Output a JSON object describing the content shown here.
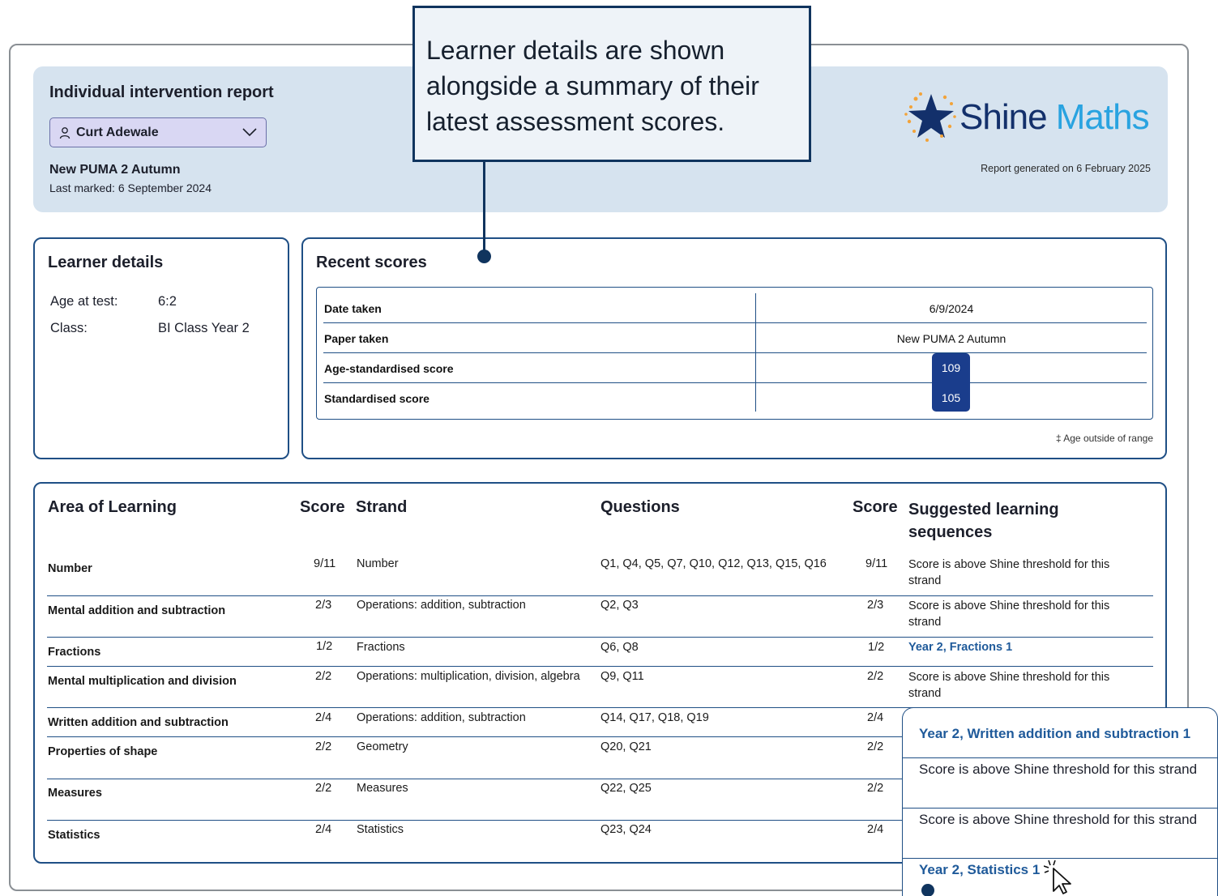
{
  "header": {
    "title": "Individual intervention report",
    "learner": "Curt Adewale",
    "paper": "New PUMA 2 Autumn",
    "last_marked": "Last marked: 6 September 2024",
    "logo_part1": "Shine",
    "logo_part2": " Maths",
    "generated": "Report generated on 6 February 2025"
  },
  "callout": {
    "text": "Learner details are shown alongside a summary of their latest assessment scores."
  },
  "learner_details": {
    "title": "Learner details",
    "age_label": "Age at test:",
    "age_value": "6:2",
    "class_label": "Class:",
    "class_value": "BI Class Year 2"
  },
  "recent_scores": {
    "title": "Recent scores",
    "rows": [
      {
        "label": "Date taken",
        "value": "6/9/2024"
      },
      {
        "label": "Paper taken",
        "value": "New PUMA 2 Autumn"
      },
      {
        "label": "Age-standardised score",
        "value": "109"
      },
      {
        "label": "Standardised score",
        "value": "105"
      }
    ],
    "note": "‡ Age outside of range"
  },
  "areas": {
    "headers": {
      "area": "Area of Learning",
      "score": "Score",
      "strand": "Strand",
      "questions": "Questions",
      "score2": "Score",
      "suggested": "Suggested learning sequences"
    },
    "rows": [
      {
        "area": "Number",
        "score": "9/11",
        "strand": "Number",
        "questions": "Q1, Q4, Q5, Q7, Q10, Q12, Q13, Q15, Q16",
        "score2": "9/11",
        "suggested": "Score is above Shine threshold for this strand"
      },
      {
        "area": "Mental addition and subtraction",
        "score": "2/3",
        "strand": "Operations: addition, subtraction",
        "questions": "Q2, Q3",
        "score2": "2/3",
        "suggested": "Score is above Shine threshold for this strand"
      },
      {
        "area": "Fractions",
        "score": "1/2",
        "strand": "Fractions",
        "questions": "Q6, Q8",
        "score2": "1/2",
        "suggested": "Year 2, Fractions 1"
      },
      {
        "area": "Mental multiplication and division",
        "score": "2/2",
        "strand": "Operations: multiplication, division, algebra",
        "questions": "Q9, Q11",
        "score2": "2/2",
        "suggested": "Score is above Shine threshold for this strand"
      },
      {
        "area": "Written addition and subtraction",
        "score": "2/4",
        "strand": "Operations: addition, subtraction",
        "questions": "Q14, Q17, Q18, Q19",
        "score2": "2/4",
        "suggested": ""
      },
      {
        "area": "Properties of shape",
        "score": "2/2",
        "strand": "Geometry",
        "questions": "Q20, Q21",
        "score2": "2/2",
        "suggested": ""
      },
      {
        "area": "Measures",
        "score": "2/2",
        "strand": "Measures",
        "questions": "Q22, Q25",
        "score2": "2/2",
        "suggested": ""
      },
      {
        "area": "Statistics",
        "score": "2/4",
        "strand": "Statistics",
        "questions": "Q23, Q24",
        "score2": "2/4",
        "suggested": ""
      }
    ]
  },
  "popup": {
    "items": [
      "Year 2, Written addition and subtraction 1",
      "Score is above Shine threshold for this strand",
      "Score is above Shine threshold for this strand",
      "Year 2, Statistics 1"
    ]
  },
  "colors": {
    "accent": "#1f4f85",
    "header_bg": "#d6e3ef",
    "pill": "#1a3d8c",
    "link": "#1f5a9a"
  }
}
